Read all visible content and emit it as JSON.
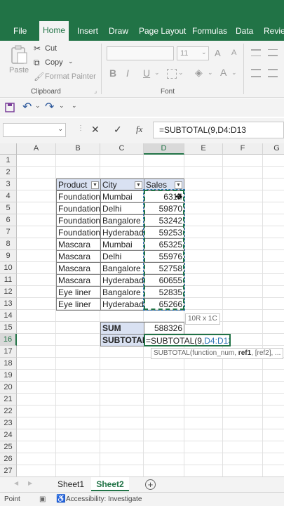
{
  "ribbon_tabs": [
    "File",
    "Home",
    "Insert",
    "Draw",
    "Page Layout",
    "Formulas",
    "Data",
    "Review"
  ],
  "active_tab": "Home",
  "clipboard": {
    "paste": "Paste",
    "cut": "Cut",
    "copy": "Copy",
    "format_painter": "Format Painter",
    "label": "Clipboard"
  },
  "font_group": {
    "size": "11",
    "label": "Font",
    "grow": "A",
    "shrink": "A",
    "bold": "B",
    "italic": "I",
    "underline": "U",
    "font_color": "A"
  },
  "formula_bar": {
    "cancel": "✕",
    "enter": "✓",
    "fx": "fx",
    "formula": "=SUBTOTAL(9,D4:D13"
  },
  "columns": [
    "A",
    "B",
    "C",
    "D",
    "E",
    "F",
    "G"
  ],
  "rows": [
    "1",
    "2",
    "3",
    "4",
    "5",
    "6",
    "7",
    "8",
    "9",
    "10",
    "11",
    "12",
    "13",
    "14",
    "15",
    "16",
    "17",
    "18",
    "19",
    "20",
    "21",
    "22",
    "23",
    "24",
    "25",
    "26",
    "27"
  ],
  "table": {
    "headers": [
      "Product",
      "City",
      "Sales"
    ],
    "rows": [
      [
        "Foundation",
        "Mumbai",
        "6314"
      ],
      [
        "Foundation",
        "Delhi",
        "59870"
      ],
      [
        "Foundation",
        "Bangalore",
        "53242"
      ],
      [
        "Foundation",
        "Hyderabad",
        "59253"
      ],
      [
        "Mascara",
        "Mumbai",
        "65325"
      ],
      [
        "Mascara",
        "Delhi",
        "55976"
      ],
      [
        "Mascara",
        "Bangalore",
        "52758"
      ],
      [
        "Mascara",
        "Hyderabad",
        "60655"
      ],
      [
        "Eye liner",
        "Bangalore",
        "52835"
      ],
      [
        "Eye liner",
        "Hyderabad",
        "65266"
      ]
    ]
  },
  "summary": {
    "sum_label": "SUM",
    "sum_value": "588326",
    "subtotal_label": "SUBTOTAL",
    "subtotal_formula_prefix": "=SUBTOTAL(",
    "subtotal_formula_num": "9,",
    "subtotal_formula_ref": "D4:D13",
    "subtotal_formula_suffix": ")"
  },
  "range_tip": "10R x 1C",
  "arg_tip": {
    "prefix": "SUBTOTAL(function_num, ",
    "bold": "ref1",
    "suffix": ", [ref2], ..."
  },
  "sheets": [
    "Sheet1",
    "Sheet2"
  ],
  "active_sheet": "Sheet2",
  "status": {
    "mode": "Point",
    "accessibility": "Accessibility: Investigate"
  },
  "colors": {
    "excel_green": "#217346",
    "table_header": "#d9e1f2",
    "ref_blue": "#2e75b6"
  }
}
